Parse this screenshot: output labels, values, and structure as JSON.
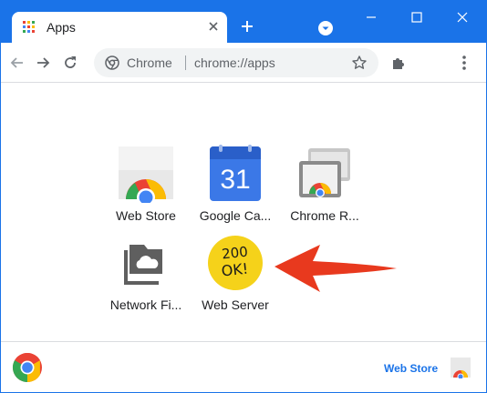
{
  "browser": {
    "tab_title": "Apps",
    "accent": "#1a73e8"
  },
  "omnibox": {
    "chip_label": "Chrome",
    "url": "chrome://apps"
  },
  "apps": [
    {
      "label": "Web Store",
      "icon": "web-store-icon"
    },
    {
      "label": "Google Ca...",
      "icon": "google-calendar-icon"
    },
    {
      "label": "Chrome R...",
      "icon": "chrome-remote-desktop-icon"
    },
    {
      "label": "Network Fi...",
      "icon": "network-file-share-icon"
    },
    {
      "label": "Web Server",
      "icon": "web-server-icon",
      "icon_text_line1": "200",
      "icon_text_line2": "OK!"
    }
  ],
  "calendar_day": "31",
  "bottom_bar": {
    "web_store_link": "Web Store"
  },
  "colors": {
    "arrow": "#e8391e",
    "web_server_badge": "#f5d21a"
  }
}
